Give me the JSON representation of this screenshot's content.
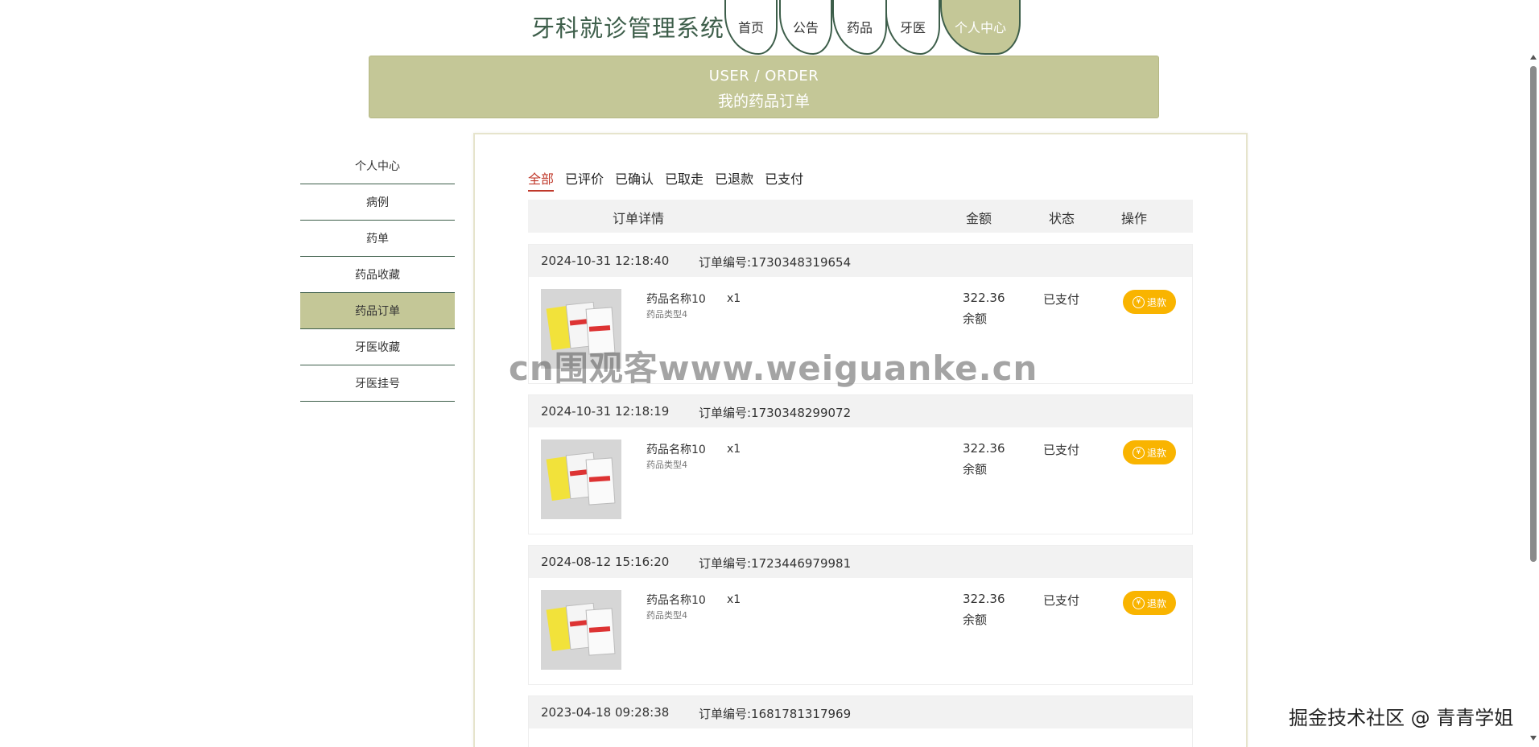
{
  "header": {
    "site_title": "牙科就诊管理系统",
    "nav": [
      {
        "label": "首页"
      },
      {
        "label": "公告"
      },
      {
        "label": "药品"
      },
      {
        "label": "牙医"
      },
      {
        "label": "个人中心"
      }
    ]
  },
  "banner": {
    "en": "USER / ORDER",
    "cn": "我的药品订单"
  },
  "sidebar": {
    "items": [
      {
        "label": "个人中心"
      },
      {
        "label": "病例"
      },
      {
        "label": "药单"
      },
      {
        "label": "药品收藏"
      },
      {
        "label": "药品订单"
      },
      {
        "label": "牙医收藏"
      },
      {
        "label": "牙医挂号"
      }
    ],
    "active": "药品订单"
  },
  "filters": [
    "全部",
    "已评价",
    "已确认",
    "已取走",
    "已退款",
    "已支付"
  ],
  "active_filter": "全部",
  "table_head": {
    "detail": "订单详情",
    "amount": "金额",
    "status": "状态",
    "action": "操作"
  },
  "orders": [
    {
      "time": "2024-10-31 12:18:40",
      "order_no": "订单编号:1730348319654",
      "product_name": "药品名称10",
      "product_type": "药品类型4",
      "qty": "x1",
      "amount": "322.36",
      "pay_method": "余额",
      "status": "已支付",
      "action": "退款"
    },
    {
      "time": "2024-10-31 12:18:19",
      "order_no": "订单编号:1730348299072",
      "product_name": "药品名称10",
      "product_type": "药品类型4",
      "qty": "x1",
      "amount": "322.36",
      "pay_method": "余额",
      "status": "已支付",
      "action": "退款"
    },
    {
      "time": "2024-08-12 15:16:20",
      "order_no": "订单编号:1723446979981",
      "product_name": "药品名称10",
      "product_type": "药品类型4",
      "qty": "x1",
      "amount": "322.36",
      "pay_method": "余额",
      "status": "已支付",
      "action": "退款"
    },
    {
      "time": "2023-04-18 09:28:38",
      "order_no": "订单编号:1681781317969"
    }
  ],
  "watermarks": {
    "center": "cn围观客www.weiguanke.cn",
    "corner": "掘金技术社区 @ 青青学姐"
  },
  "colors": {
    "accent": "#c4c797",
    "nav_border": "#3d5e4a",
    "active_filter": "#c0392b",
    "refund_button": "#f9b400"
  }
}
